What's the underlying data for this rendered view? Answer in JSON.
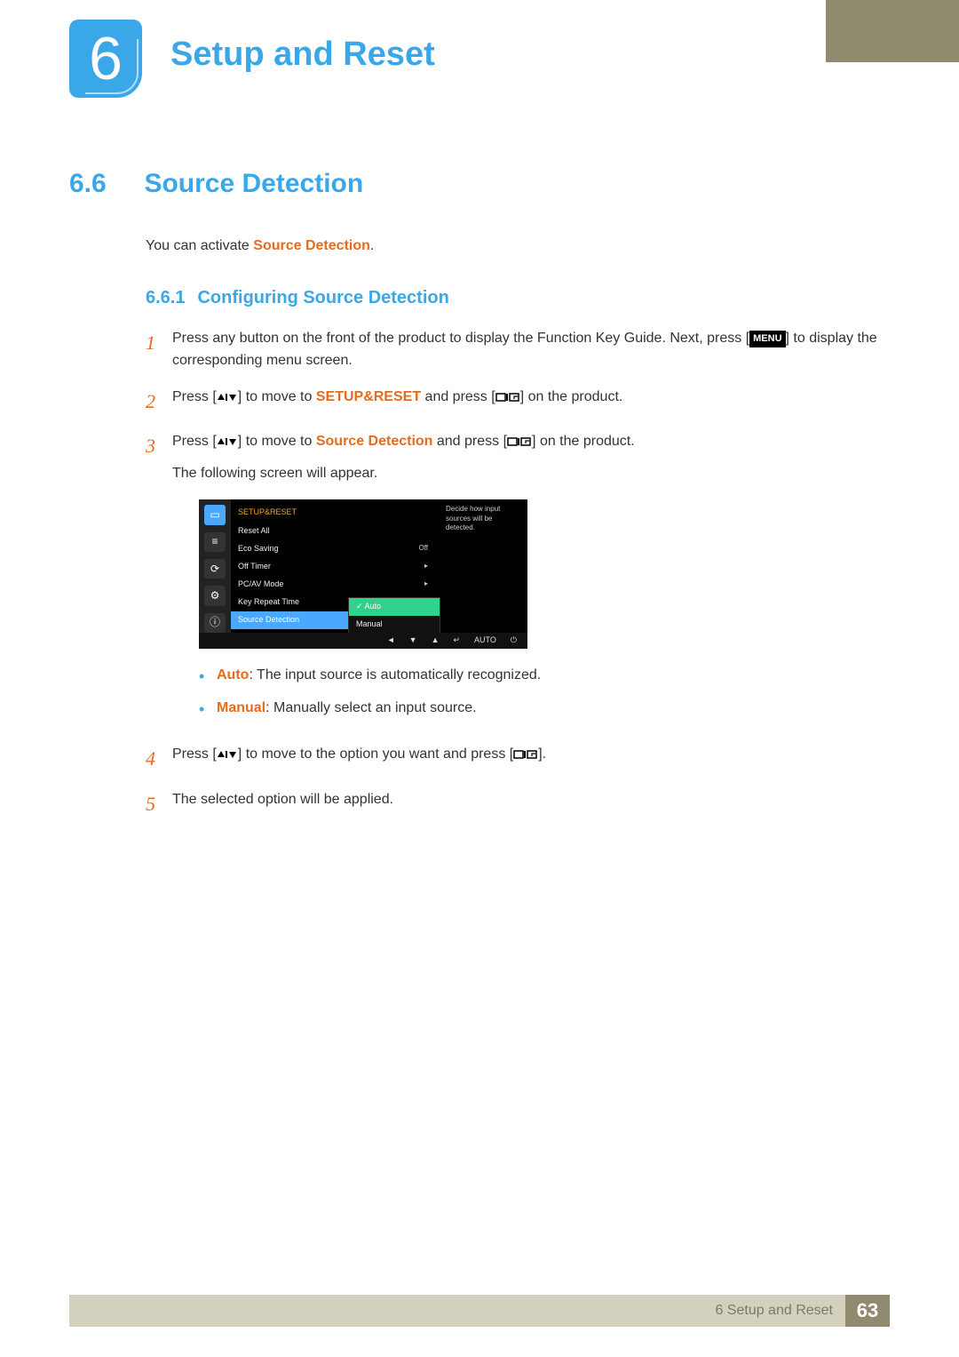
{
  "chapter": {
    "number": "6",
    "title": "Setup and Reset"
  },
  "section": {
    "number": "6.6",
    "title": "Source Detection"
  },
  "intro": {
    "prefix": "You can activate ",
    "highlight": "Source Detection",
    "suffix": "."
  },
  "subsection": {
    "number": "6.6.1",
    "title": "Configuring Source Detection"
  },
  "menu_key_label": "MENU",
  "steps": {
    "s1": {
      "num": "1",
      "a": "Press any button on the front of the product to display the Function Key Guide. Next, press [",
      "b": "] to display the corresponding menu screen."
    },
    "s2": {
      "num": "2",
      "a": "Press [",
      "b": "] to move to ",
      "hl": "SETUP&RESET",
      "c": " and press [",
      "d": "] on the product."
    },
    "s3": {
      "num": "3",
      "a": "Press [",
      "b": "] to move to ",
      "hl": "Source Detection",
      "c": " and press [",
      "d": "] on the product.",
      "followup": "The following screen will appear."
    },
    "s4": {
      "num": "4",
      "a": "Press [",
      "b": "] to move to the option you want and press [",
      "c": "]."
    },
    "s5": {
      "num": "5",
      "a": "The selected option will be applied."
    }
  },
  "bullets": {
    "auto": {
      "hl": "Auto",
      "txt": ": The input source is automatically recognized."
    },
    "manual": {
      "hl": "Manual",
      "txt": ": Manually select an input source."
    }
  },
  "osd": {
    "header": "SETUP&RESET",
    "items": {
      "reset": "Reset All",
      "eco": "Eco Saving",
      "eco_val": "Off",
      "offtimer": "Off Timer",
      "pcav": "PC/AV Mode",
      "keyrep": "Key Repeat Time",
      "source": "Source Detection"
    },
    "options": {
      "auto": "Auto",
      "manual": "Manual"
    },
    "help": "Decide how input sources will be detected.",
    "footer_auto": "AUTO"
  },
  "footer": {
    "label": "6 Setup and Reset",
    "page": "63"
  }
}
